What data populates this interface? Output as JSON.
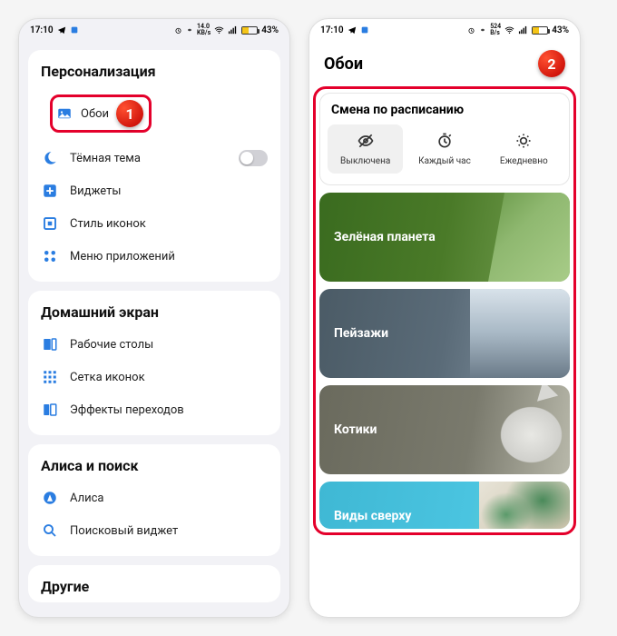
{
  "status": {
    "time": "17:10",
    "speed": "14.0",
    "speed_unit": "KB/s",
    "speed2": "524",
    "speed2_unit": "B/s",
    "battery": "43%"
  },
  "steps": {
    "one": "1",
    "two": "2"
  },
  "screen1": {
    "section_personalization": "Персонализация",
    "wallpaper": "Обои",
    "dark_theme": "Тёмная тема",
    "widgets": "Виджеты",
    "icon_style": "Стиль иконок",
    "app_menu": "Меню приложений",
    "section_home": "Домашний экран",
    "desktops": "Рабочие столы",
    "icon_grid": "Сетка иконок",
    "transition_effects": "Эффекты переходов",
    "section_alice": "Алиса и поиск",
    "alice": "Алиса",
    "search_widget": "Поисковый виджет",
    "section_other": "Другие"
  },
  "screen2": {
    "title": "Обои",
    "schedule_title": "Смена по расписанию",
    "opt_off": "Выключена",
    "opt_hourly": "Каждый час",
    "opt_daily": "Ежедневно",
    "wp_green": "Зелёная планета",
    "wp_landscapes": "Пейзажи",
    "wp_cats": "Котики",
    "wp_top": "Виды сверху"
  }
}
